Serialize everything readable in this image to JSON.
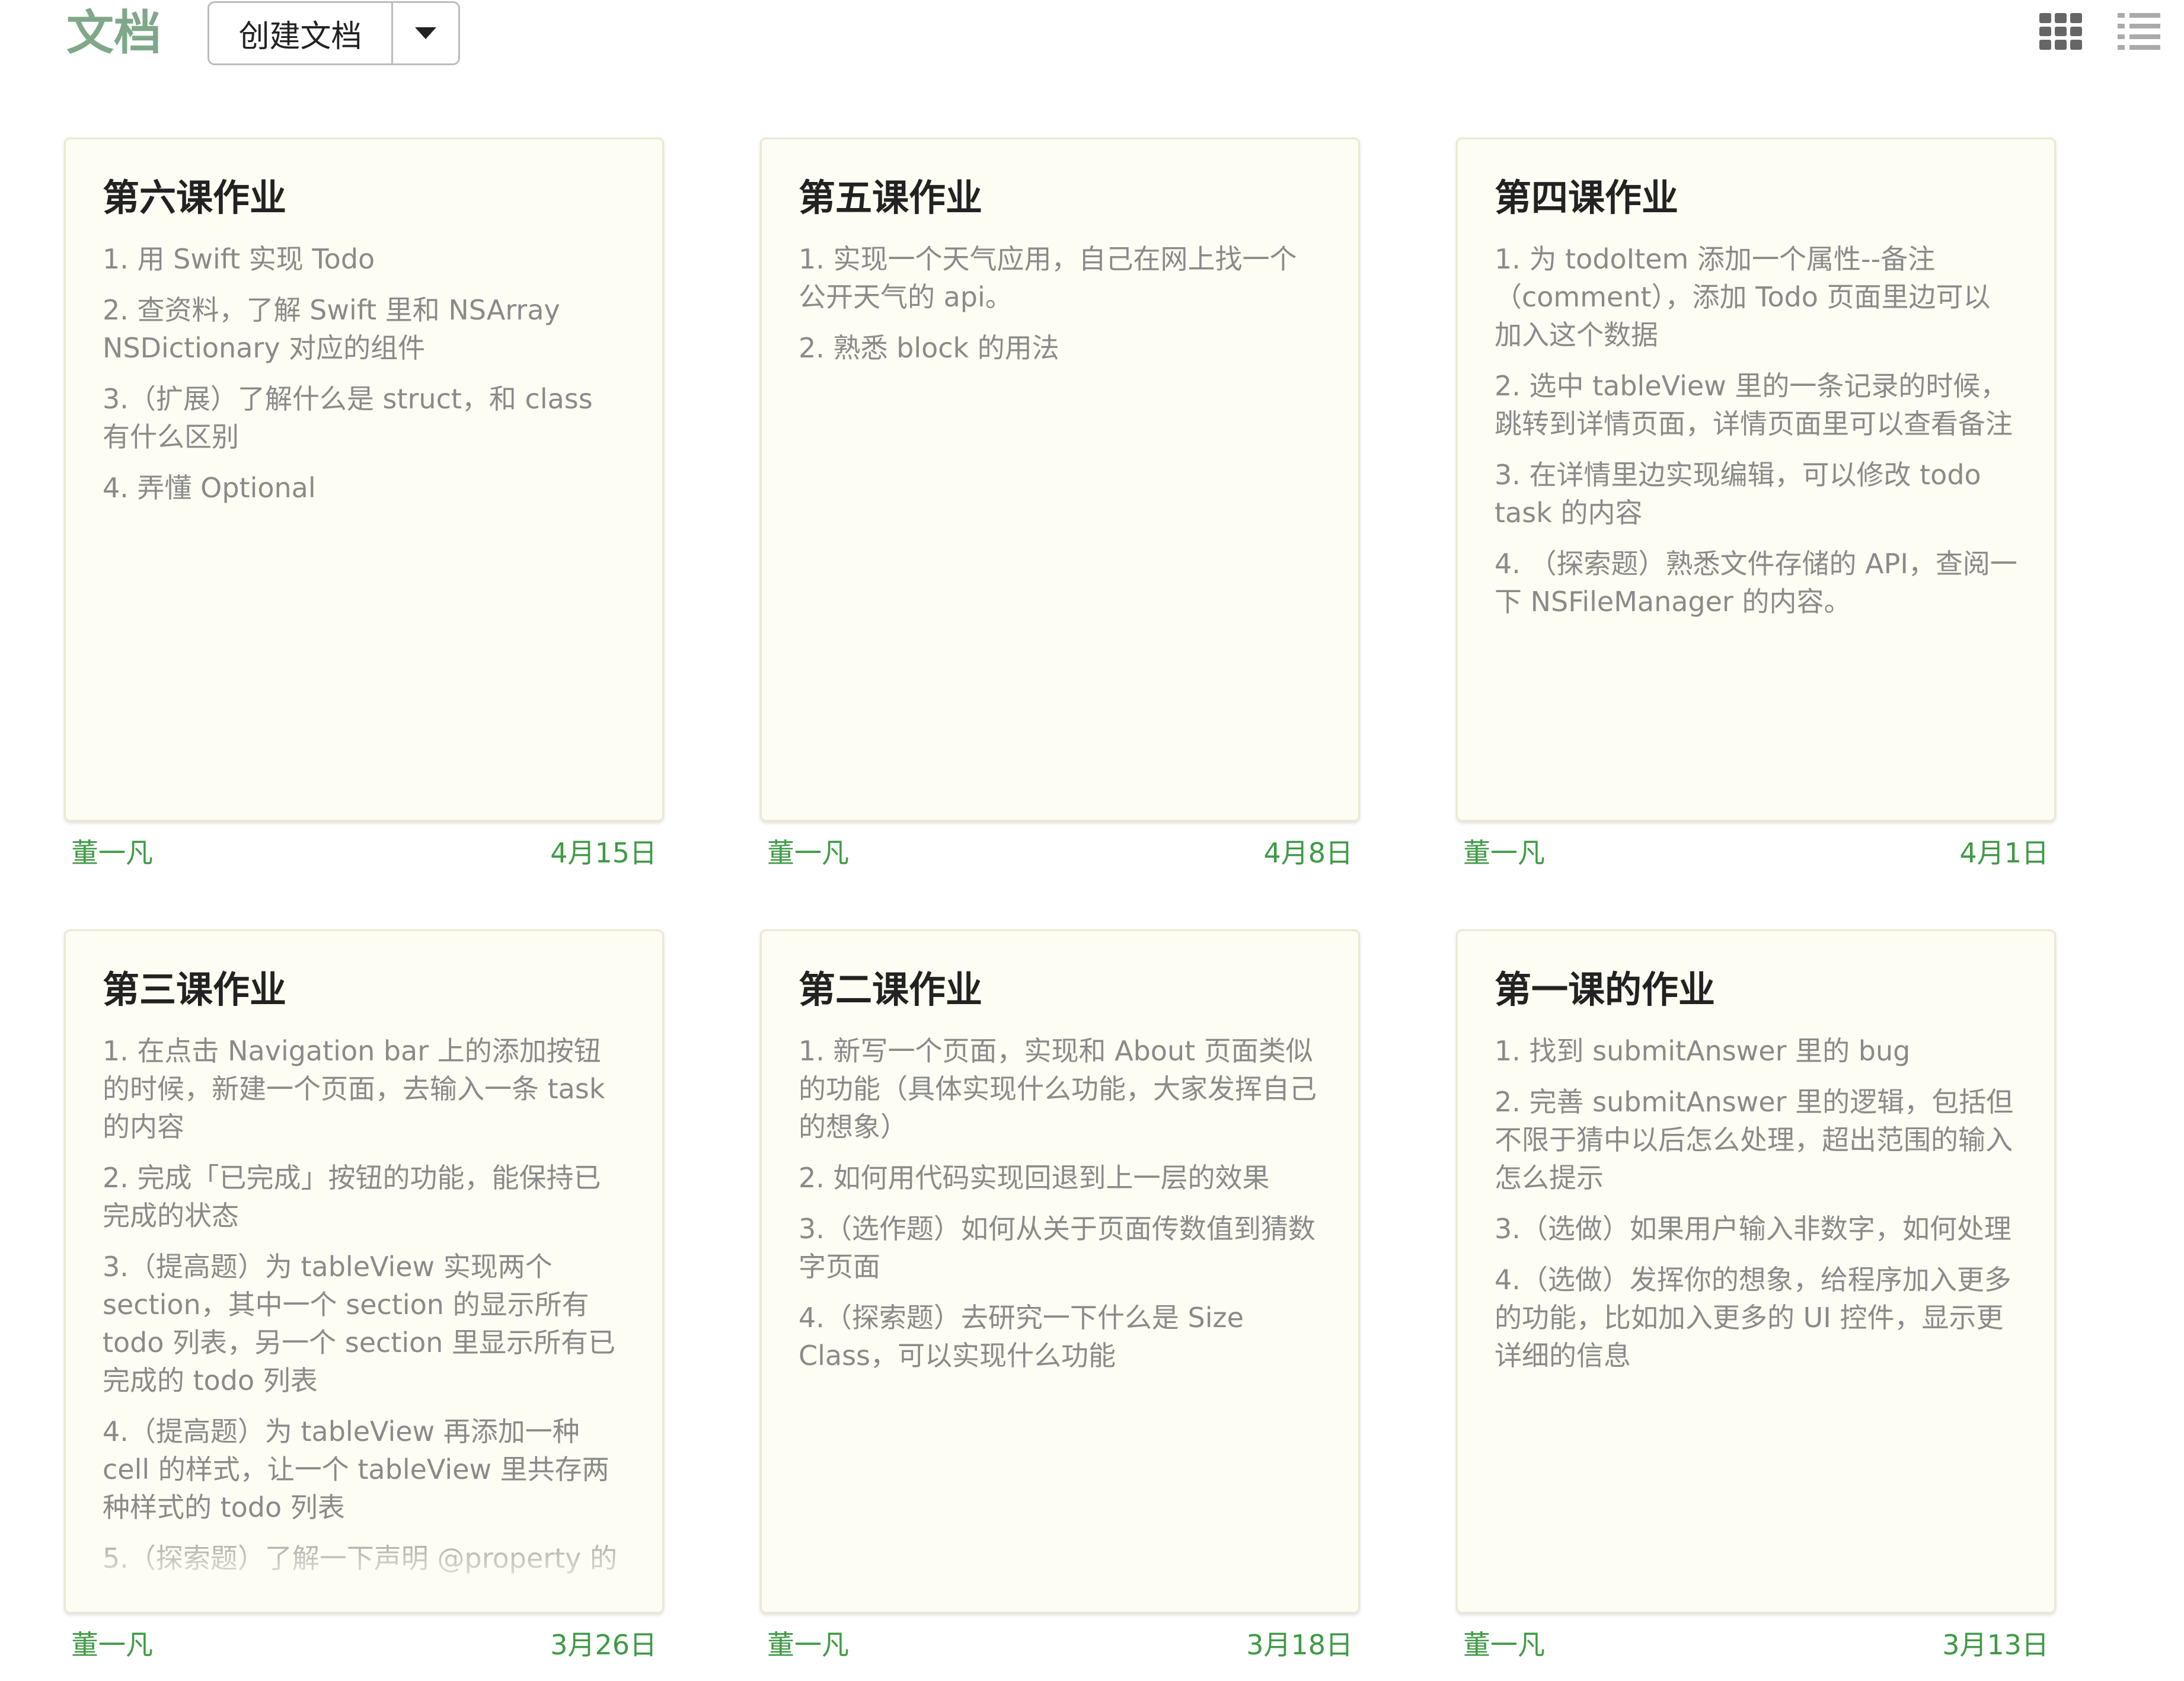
{
  "header": {
    "title": "文档",
    "create_label": "创建文档",
    "icons": [
      "chevron-down-icon",
      "grid-view-icon",
      "list-view-icon"
    ]
  },
  "colors": {
    "accent_green": "#3f9a45",
    "title_green": "#7fa889",
    "card_bg": "#fefdf3"
  },
  "cards": [
    {
      "title": "第六课作业",
      "lines": [
        "1. 用 Swift 实现 Todo",
        "2. 查资料，了解 Swift 里和 NSArray NSDictionary 对应的组件",
        "3.（扩展）了解什么是 struct，和 class 有什么区别",
        "4. 弄懂 Optional"
      ],
      "author": "董一凡",
      "date": "4月15日"
    },
    {
      "title": "第五课作业",
      "lines": [
        "1. 实现一个天气应用，自己在网上找一个公开天气的 api。",
        "2. 熟悉 block 的用法"
      ],
      "author": "董一凡",
      "date": "4月8日"
    },
    {
      "title": "第四课作业",
      "lines": [
        "1. 为 todoItem 添加一个属性--备注（comment），添加 Todo 页面里边可以加入这个数据",
        "2. 选中 tableView 里的一条记录的时候，跳转到详情页面，详情页面里可以查看备注",
        "3. 在详情里边实现编辑，可以修改 todo task 的内容",
        "4. （探索题）熟悉文件存储的 API，查阅一下 NSFileManager 的内容。"
      ],
      "author": "董一凡",
      "date": "4月1日"
    },
    {
      "title": "第三课作业",
      "lines": [
        "1. 在点击 Navigation bar 上的添加按钮的时候，新建一个页面，去输入一条 task 的内容",
        "2. 完成「已完成」按钮的功能，能保持已完成的状态",
        "3.（提高题）为 tableView 实现两个 section，其中一个 section 的显示所有 todo 列表，另一个 section 里显示所有已完成的 todo 列表",
        "4.（提高题）为 tableView 再添加一种 cell 的样式，让一个 tableView 里共存两种样式的 todo 列表",
        "5.（探索题）了解一下声明 @property 的"
      ],
      "author": "董一凡",
      "date": "3月26日"
    },
    {
      "title": "第二课作业",
      "lines": [
        "1. 新写一个页面，实现和 About 页面类似的功能（具体实现什么功能，大家发挥自己的想象）",
        "2. 如何用代码实现回退到上一层的效果",
        "3.（选作题）如何从关于页面传数值到猜数字页面",
        "4.（探索题）去研究一下什么是 Size Class，可以实现什么功能"
      ],
      "author": "董一凡",
      "date": "3月18日"
    },
    {
      "title": "第一课的作业",
      "lines": [
        "1. 找到 submitAnswer 里的 bug",
        "2. 完善 submitAnswer 里的逻辑，包括但不限于猜中以后怎么处理，超出范围的输入怎么提示",
        "3.（选做）如果用户输入非数字，如何处理",
        "4.（选做）发挥你的想象，给程序加入更多的功能，比如加入更多的 UI 控件，显示更详细的信息"
      ],
      "author": "董一凡",
      "date": "3月13日"
    }
  ]
}
